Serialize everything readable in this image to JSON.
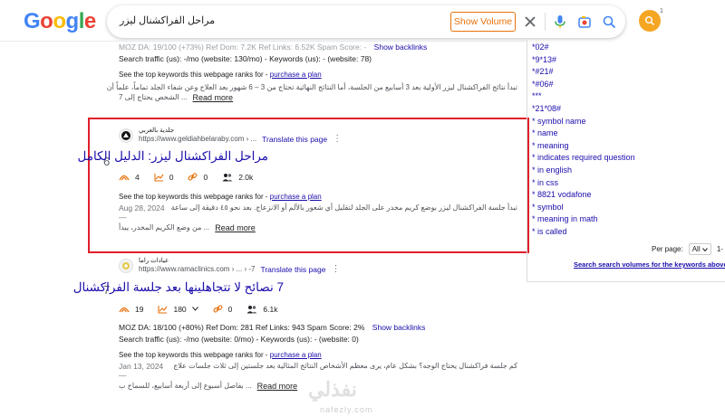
{
  "header": {
    "logo_letters": [
      {
        "ch": "G",
        "color": "#4285F4"
      },
      {
        "ch": "o",
        "color": "#EA4335"
      },
      {
        "ch": "o",
        "color": "#FBBC05"
      },
      {
        "ch": "g",
        "color": "#4285F4"
      },
      {
        "ch": "l",
        "color": "#34A853"
      },
      {
        "ch": "e",
        "color": "#EA4335"
      }
    ],
    "search_query": "مراحل الفراكشنال ليزر",
    "show_volume_label": "Show Volume",
    "avatar_badge": "1"
  },
  "result_top": {
    "metrics_line_cut": "MOZ DA: 19/100 (+73%)   Ref Dom: 7.2K   Ref Links: 6.52K   Spam Score: -",
    "show_backlinks": "Show backlinks",
    "traffic_line": "Search traffic (us): -/mo (website: 130/mo) - Keywords (us): - (website: 78)",
    "keywords_prefix": "See the top keywords this webpage ranks for -",
    "purchase_plan": "purchase a plan",
    "snippet_line1": "تبدأ نتائج الفراكشنال ليزر الأولية بعد 3 أسابيع من الجلسة، أما النتائج النهائية تحتاج من 3 – 6 شهور بعد العلاج وعن شفاء الجلد تماماً، علماً أن",
    "snippet_line2": "... الشخص يحتاج إلى 7",
    "read_more": "Read more"
  },
  "result_6": {
    "rank": "6",
    "site_name": "جلدية بالعربي",
    "site_url": "https://www.geldiahbelaraby.com › ...",
    "translate": "Translate this page",
    "kebab": "⋮",
    "title": "مراحل الفراكشنال ليزر: الدليل الكامل",
    "stats": [
      "4",
      "0",
      "0",
      "2.0k"
    ],
    "keywords_prefix": "See the top keywords this webpage ranks for -",
    "purchase_plan": "purchase a plan",
    "date": "Aug 28, 2024 —",
    "snippet_line1": "تبدأ جلسة الفراكشنال ليزر بوضع كريم مخدر على الجلد لتقليل أي شعور بالألم أو الانزعاج. بعد نحو ٤٥ دقيقة إلى ساعة",
    "snippet_line2": "... من وضع الكريم المخدر، يبدأ",
    "read_more": "Read more"
  },
  "result_7": {
    "rank": "7",
    "site_name": "عيادات راما",
    "site_url": "https://www.ramaclinics.com › ... › -7",
    "translate": "Translate this page",
    "kebab": "⋮",
    "title": "7 نصائح لا تتجاهلينها بعد جلسة الفراكشنال",
    "stats": [
      "19",
      "180",
      "0",
      "6.1k"
    ],
    "metrics_line": "MOZ DA: 18/100 (+80%)   Ref Dom: 281   Ref Links: 943   Spam Score: 2%",
    "show_backlinks": "Show backlinks",
    "traffic_line": "Search traffic (us): -/mo (website: 0/mo) - Keywords (us): - (website: 0)",
    "keywords_prefix": "See the top keywords this webpage ranks for -",
    "purchase_plan": "purchase a plan",
    "date": "Jan 13, 2024 —",
    "snippet_line1": "كم جلسة فراكشنال يحتاج الوجه؟ بشكل عام، يرى معظم الأشخاص النتائج المثالية بعد جلستين إلى ثلاث جلسات علاج",
    "snippet_line2": "... بفاصل أسبوع إلى أربعة أسابيع، للسماح ب",
    "read_more": "Read more"
  },
  "right_panel": {
    "items": [
      "*02#",
      "*9*13#",
      "*#21#",
      "*#06#",
      "***",
      "*21*08#",
      "* symbol name",
      "* name",
      "* meaning",
      "* indicates required question",
      "* in english",
      "* in css",
      "* 8821 vodafone",
      "* symbol",
      "* meaning in math",
      "* is called"
    ],
    "per_page_label": "Per page:",
    "per_page_value": "All",
    "per_page_extra": "1-",
    "search_volumes_link": "Search search volumes for the keywords above"
  },
  "watermark": {
    "text": "نفذلي",
    "sub": "nafezly.com"
  }
}
